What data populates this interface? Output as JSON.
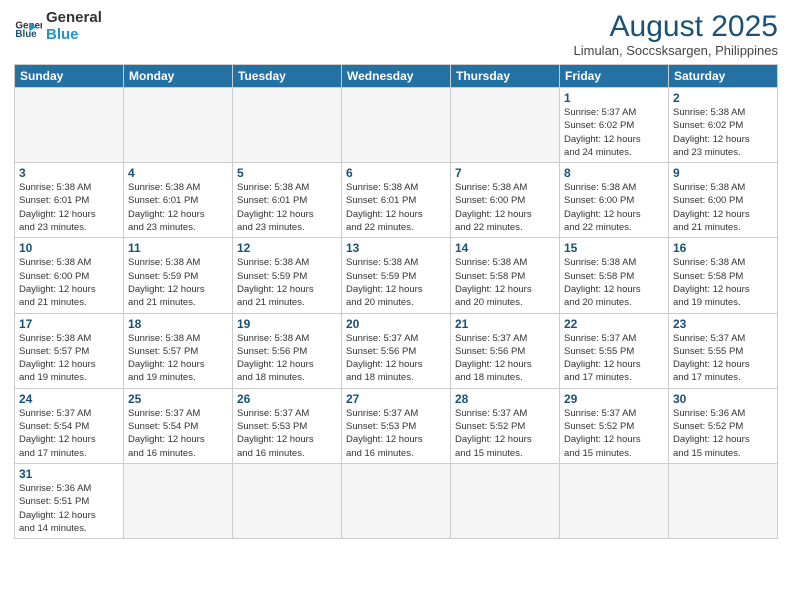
{
  "logo": {
    "general": "General",
    "blue": "Blue"
  },
  "title": {
    "month_year": "August 2025",
    "location": "Limulan, Soccsksargen, Philippines"
  },
  "days_of_week": [
    "Sunday",
    "Monday",
    "Tuesday",
    "Wednesday",
    "Thursday",
    "Friday",
    "Saturday"
  ],
  "weeks": [
    [
      {
        "num": "",
        "info": ""
      },
      {
        "num": "",
        "info": ""
      },
      {
        "num": "",
        "info": ""
      },
      {
        "num": "",
        "info": ""
      },
      {
        "num": "",
        "info": ""
      },
      {
        "num": "1",
        "info": "Sunrise: 5:37 AM\nSunset: 6:02 PM\nDaylight: 12 hours\nand 24 minutes."
      },
      {
        "num": "2",
        "info": "Sunrise: 5:38 AM\nSunset: 6:02 PM\nDaylight: 12 hours\nand 23 minutes."
      }
    ],
    [
      {
        "num": "3",
        "info": "Sunrise: 5:38 AM\nSunset: 6:01 PM\nDaylight: 12 hours\nand 23 minutes."
      },
      {
        "num": "4",
        "info": "Sunrise: 5:38 AM\nSunset: 6:01 PM\nDaylight: 12 hours\nand 23 minutes."
      },
      {
        "num": "5",
        "info": "Sunrise: 5:38 AM\nSunset: 6:01 PM\nDaylight: 12 hours\nand 23 minutes."
      },
      {
        "num": "6",
        "info": "Sunrise: 5:38 AM\nSunset: 6:01 PM\nDaylight: 12 hours\nand 22 minutes."
      },
      {
        "num": "7",
        "info": "Sunrise: 5:38 AM\nSunset: 6:00 PM\nDaylight: 12 hours\nand 22 minutes."
      },
      {
        "num": "8",
        "info": "Sunrise: 5:38 AM\nSunset: 6:00 PM\nDaylight: 12 hours\nand 22 minutes."
      },
      {
        "num": "9",
        "info": "Sunrise: 5:38 AM\nSunset: 6:00 PM\nDaylight: 12 hours\nand 21 minutes."
      }
    ],
    [
      {
        "num": "10",
        "info": "Sunrise: 5:38 AM\nSunset: 6:00 PM\nDaylight: 12 hours\nand 21 minutes."
      },
      {
        "num": "11",
        "info": "Sunrise: 5:38 AM\nSunset: 5:59 PM\nDaylight: 12 hours\nand 21 minutes."
      },
      {
        "num": "12",
        "info": "Sunrise: 5:38 AM\nSunset: 5:59 PM\nDaylight: 12 hours\nand 21 minutes."
      },
      {
        "num": "13",
        "info": "Sunrise: 5:38 AM\nSunset: 5:59 PM\nDaylight: 12 hours\nand 20 minutes."
      },
      {
        "num": "14",
        "info": "Sunrise: 5:38 AM\nSunset: 5:58 PM\nDaylight: 12 hours\nand 20 minutes."
      },
      {
        "num": "15",
        "info": "Sunrise: 5:38 AM\nSunset: 5:58 PM\nDaylight: 12 hours\nand 20 minutes."
      },
      {
        "num": "16",
        "info": "Sunrise: 5:38 AM\nSunset: 5:58 PM\nDaylight: 12 hours\nand 19 minutes."
      }
    ],
    [
      {
        "num": "17",
        "info": "Sunrise: 5:38 AM\nSunset: 5:57 PM\nDaylight: 12 hours\nand 19 minutes."
      },
      {
        "num": "18",
        "info": "Sunrise: 5:38 AM\nSunset: 5:57 PM\nDaylight: 12 hours\nand 19 minutes."
      },
      {
        "num": "19",
        "info": "Sunrise: 5:38 AM\nSunset: 5:56 PM\nDaylight: 12 hours\nand 18 minutes."
      },
      {
        "num": "20",
        "info": "Sunrise: 5:37 AM\nSunset: 5:56 PM\nDaylight: 12 hours\nand 18 minutes."
      },
      {
        "num": "21",
        "info": "Sunrise: 5:37 AM\nSunset: 5:56 PM\nDaylight: 12 hours\nand 18 minutes."
      },
      {
        "num": "22",
        "info": "Sunrise: 5:37 AM\nSunset: 5:55 PM\nDaylight: 12 hours\nand 17 minutes."
      },
      {
        "num": "23",
        "info": "Sunrise: 5:37 AM\nSunset: 5:55 PM\nDaylight: 12 hours\nand 17 minutes."
      }
    ],
    [
      {
        "num": "24",
        "info": "Sunrise: 5:37 AM\nSunset: 5:54 PM\nDaylight: 12 hours\nand 17 minutes."
      },
      {
        "num": "25",
        "info": "Sunrise: 5:37 AM\nSunset: 5:54 PM\nDaylight: 12 hours\nand 16 minutes."
      },
      {
        "num": "26",
        "info": "Sunrise: 5:37 AM\nSunset: 5:53 PM\nDaylight: 12 hours\nand 16 minutes."
      },
      {
        "num": "27",
        "info": "Sunrise: 5:37 AM\nSunset: 5:53 PM\nDaylight: 12 hours\nand 16 minutes."
      },
      {
        "num": "28",
        "info": "Sunrise: 5:37 AM\nSunset: 5:52 PM\nDaylight: 12 hours\nand 15 minutes."
      },
      {
        "num": "29",
        "info": "Sunrise: 5:37 AM\nSunset: 5:52 PM\nDaylight: 12 hours\nand 15 minutes."
      },
      {
        "num": "30",
        "info": "Sunrise: 5:36 AM\nSunset: 5:52 PM\nDaylight: 12 hours\nand 15 minutes."
      }
    ],
    [
      {
        "num": "31",
        "info": "Sunrise: 5:36 AM\nSunset: 5:51 PM\nDaylight: 12 hours\nand 14 minutes."
      },
      {
        "num": "",
        "info": ""
      },
      {
        "num": "",
        "info": ""
      },
      {
        "num": "",
        "info": ""
      },
      {
        "num": "",
        "info": ""
      },
      {
        "num": "",
        "info": ""
      },
      {
        "num": "",
        "info": ""
      }
    ]
  ]
}
